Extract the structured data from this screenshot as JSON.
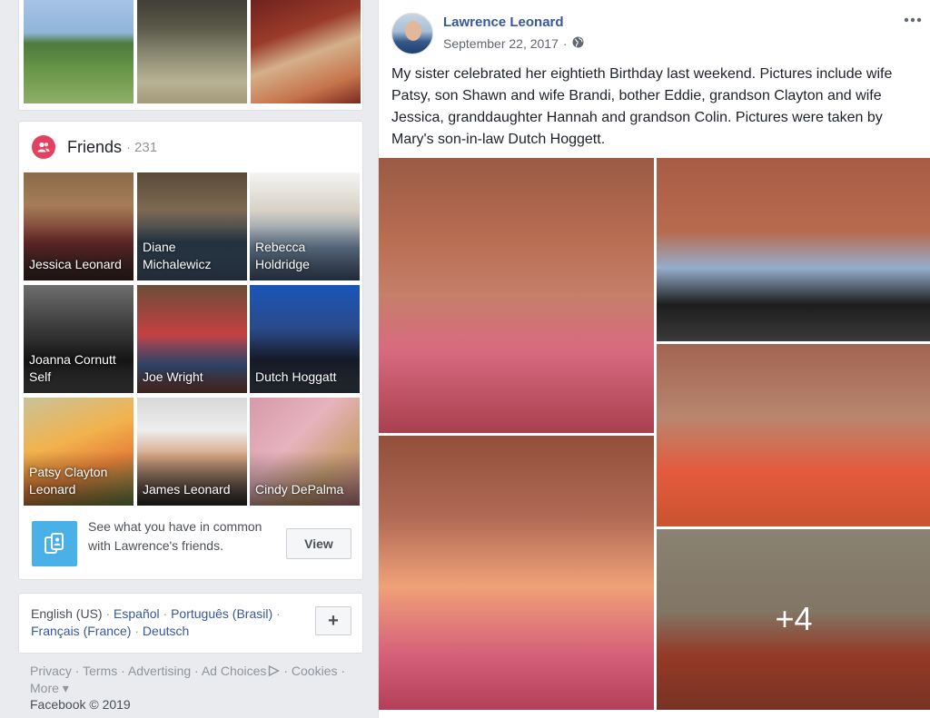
{
  "friends": {
    "title": "Friends",
    "separator": "·",
    "count": "231",
    "tiles": [
      {
        "name": "Jessica Leonard",
        "bg": "linear-gradient(180deg,#8a6a4a 0%,#a57d58 30%,#6d2b2b 65%,#3a2a2a 100%)"
      },
      {
        "name": "Diane Michalewicz",
        "bg": "linear-gradient(180deg,#5a4a38 0%,#7c6a52 35%,#2a3a4a 65%,#4a5f7a 100%)"
      },
      {
        "name": "Rebecca Holdridge",
        "bg": "linear-gradient(180deg,#f4f4f4 0%,#d8d2c6 35%,#6a7f98 70%,#4a5e7a 100%)"
      },
      {
        "name": "Joanna Cornutt Self",
        "bg": "linear-gradient(180deg,#6e6e6e 0%,#3a3a3a 40%,#1a1a1a 70%,#555555 100%)"
      },
      {
        "name": "Joe Wright",
        "bg": "linear-gradient(180deg,#6a4e3a 0%,#c44040 45%,#3c5a8a 75%,#8a4a3a 100%)"
      },
      {
        "name": "Dutch Hoggatt",
        "bg": "linear-gradient(180deg,#1a56b8 0%,#2a4a8a 40%,#1a2030 70%,#444c5a 100%)"
      },
      {
        "name": "Patsy Clayton Leonard",
        "bg": "linear-gradient(160deg,#c9c39a 0%,#f2b24c 40%,#e6823a 65%,#6a8a4a 100%)"
      },
      {
        "name": "James Leonard",
        "bg": "linear-gradient(180deg,#d8d8d8 0%,#eeeeee 30%,#d4a382 55%,#2a2a2a 100%)"
      },
      {
        "name": "Cindy DePalma",
        "bg": "linear-gradient(135deg,#d69aa8 0%,#e7b3bd 40%,#caa074 70%,#c27f8c 100%)"
      }
    ],
    "common_text": "See what you have in common with Lawrence's friends.",
    "view_label": "View"
  },
  "languages": {
    "current": "English (US)",
    "others": [
      "Español",
      "Português (Brasil)",
      "Français (France)",
      "Deutsch"
    ],
    "add_label": "+"
  },
  "footer": {
    "links": [
      "Privacy",
      "Terms",
      "Advertising",
      "Ad Choices",
      "Cookies",
      "More"
    ],
    "copyright": "Facebook © 2019"
  },
  "post": {
    "author": "Lawrence Leonard",
    "date": "September 22, 2017",
    "meta_separator": "·",
    "text": "My sister celebrated her eightieth Birthday last weekend. Pictures include wife Patsy, son Shawn and wife Brandi, bother Eddie, grandson Clayton and wife Jessica, granddaughter Hannah and grandson Colin. Pictures were taken by Mary's son-in-law Dutch Hoggett.",
    "more_photos": "+4"
  },
  "colors": {
    "link": "#385898",
    "friends_icon": "#e4405f",
    "common_icon": "#4ab1e8",
    "page_bg": "#e9ebee"
  }
}
